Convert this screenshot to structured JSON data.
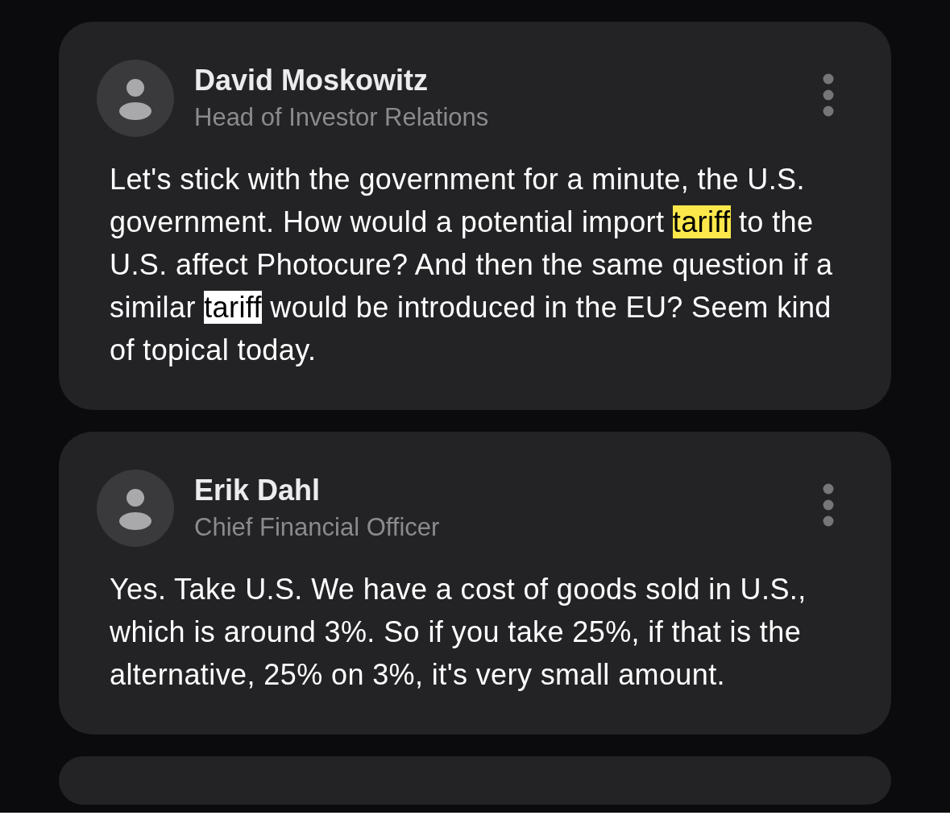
{
  "messages": [
    {
      "name": "David Moskowitz",
      "role": "Head of Investor Relations",
      "body": [
        {
          "kind": "text",
          "text": "Let's stick with the government for a minute, the U.S. government. How would a potential import "
        },
        {
          "kind": "match",
          "text": "tariff"
        },
        {
          "kind": "text",
          "text": " to the U.S. affect Photocure? And then the same question if a similar "
        },
        {
          "kind": "current",
          "text": "tariff"
        },
        {
          "kind": "text",
          "text": " would be introduced in the EU? Seem kind of topical today."
        }
      ]
    },
    {
      "name": "Erik Dahl",
      "role": "Chief Financial Officer",
      "body": [
        {
          "kind": "text",
          "text": "Yes. Take U.S. We have a cost of goods sold in U.S., which is around 3%. So if you take 25%, if that is the alternative, 25% on 3%, it's very small amount."
        }
      ]
    }
  ]
}
